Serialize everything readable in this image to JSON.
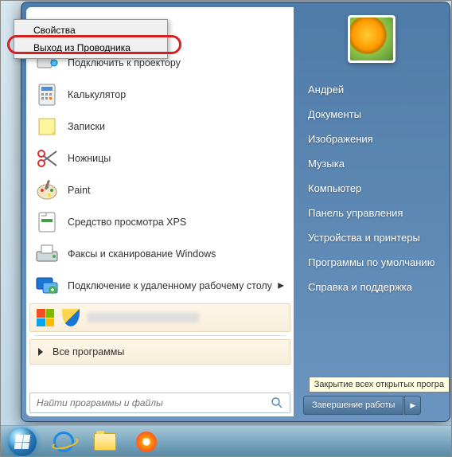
{
  "ctx": {
    "properties": "Свойства",
    "exit_explorer": "Выход из Проводника"
  },
  "programs": {
    "connect_projector": "Подключить к проектору",
    "calculator": "Калькулятор",
    "sticky_notes": "Записки",
    "snipping": "Ножницы",
    "paint": "Paint",
    "xps_viewer": "Средство просмотра XPS",
    "fax_scan": "Факсы и сканирование Windows",
    "remote_desktop": "Подключение к удаленному рабочему столу",
    "all_programs": "Все программы"
  },
  "search": {
    "placeholder": "Найти программы и файлы"
  },
  "right": {
    "user": "Андрей",
    "documents": "Документы",
    "pictures": "Изображения",
    "music": "Музыка",
    "computer": "Компьютер",
    "control_panel": "Панель управления",
    "devices": "Устройства и принтеры",
    "default_progs": "Программы по умолчанию",
    "help": "Справка и поддержка"
  },
  "shutdown": {
    "label": "Завершение работы",
    "tooltip": "Закрытие всех открытых програ"
  }
}
